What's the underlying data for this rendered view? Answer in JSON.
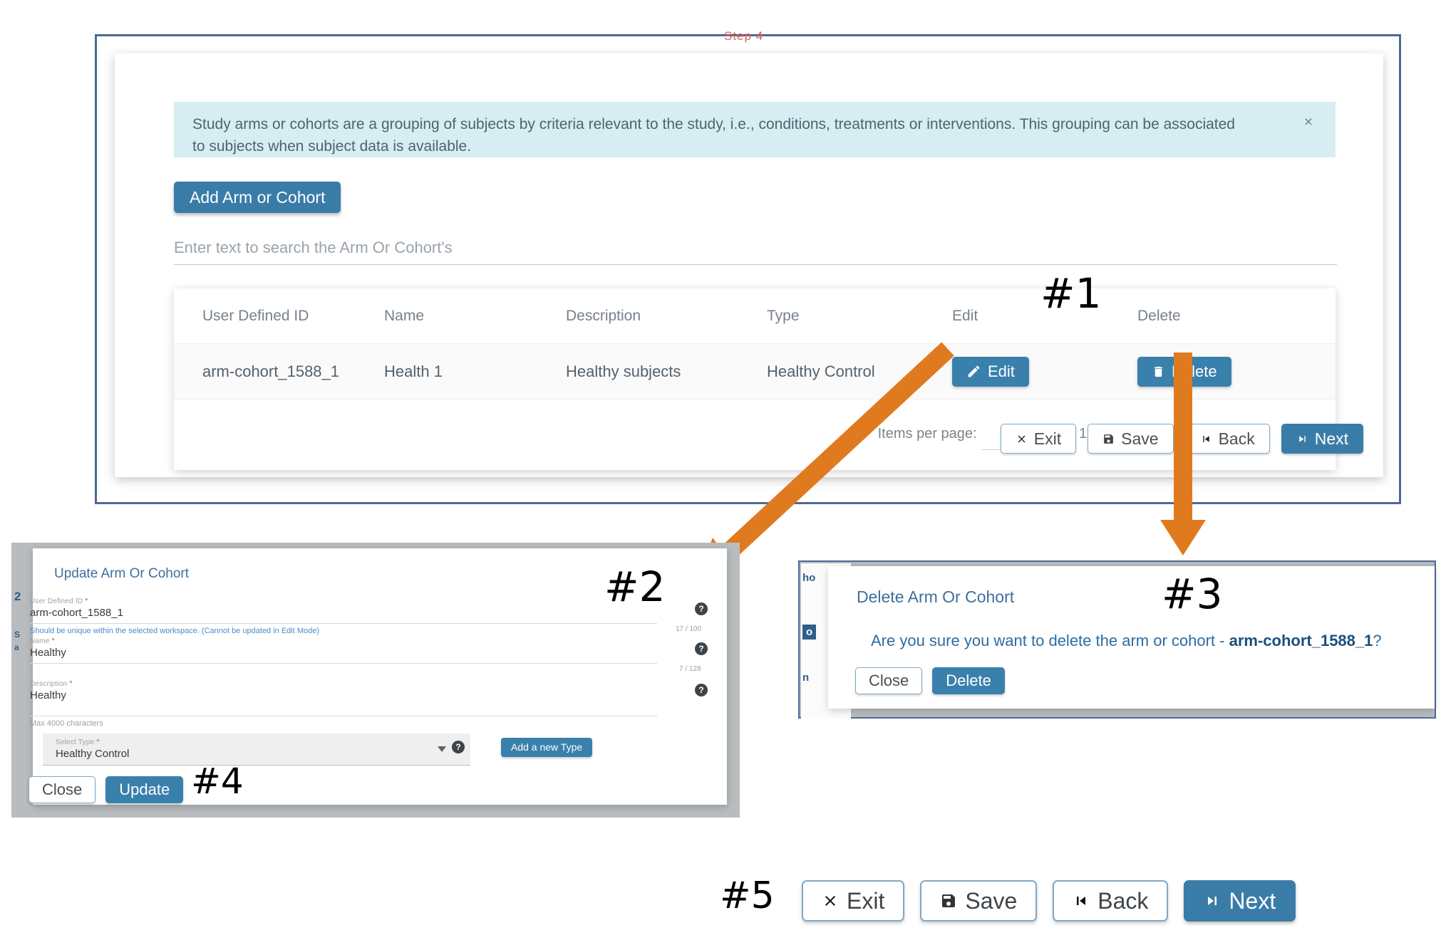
{
  "step_label": "Step 4",
  "info_banner": {
    "text": "Study arms or cohorts are a grouping of subjects by criteria relevant to the study, i.e., conditions, treatments or interventions. This grouping can be associated to subjects when subject data is available.",
    "close_icon": "close-icon",
    "close_glyph": "×",
    "background": "#d7edf1"
  },
  "add_button": {
    "label": "Add Arm or Cohort"
  },
  "search": {
    "placeholder": "Enter text to search the Arm Or Cohort's",
    "value": ""
  },
  "table": {
    "headers": [
      "User Defined ID",
      "Name",
      "Description",
      "Type",
      "Edit",
      "Delete"
    ],
    "rows": [
      {
        "user_defined_id": "arm-cohort_1588_1",
        "name": "Health 1",
        "description": "Healthy subjects",
        "type": "Healthy Control",
        "edit_label": "Edit",
        "delete_label": "Delete"
      }
    ]
  },
  "paginator": {
    "items_per_page_label": "Items per page:",
    "items_per_page_value": "",
    "range_label": "1 – 1 of 1",
    "first_page_glyph": "|‹",
    "prev_page_glyph": "‹",
    "next_page_glyph": "›",
    "last_page_glyph": "›|"
  },
  "panel_footer": {
    "exit": "Exit",
    "save": "Save",
    "back": "Back",
    "next": "Next"
  },
  "markers": {
    "one": "#1",
    "two": "#2",
    "three": "#3",
    "four": "#4",
    "five": "#5"
  },
  "update_dialog": {
    "title": "Update Arm Or Cohort",
    "fields": {
      "user_defined_id": {
        "label": "User Defined ID",
        "required_marker": "*",
        "value": "arm-cohort_1588_1",
        "hint": "Should be unique within the selected workspace. (Cannot be updated in Edit Mode)",
        "counter": "17 / 100"
      },
      "name": {
        "label": "Name",
        "required_marker": "*",
        "value": "Healthy",
        "counter": "7 / 128"
      },
      "description": {
        "label": "Description",
        "required_marker": "*",
        "value": "Healthy",
        "hint": "Max 4000 characters"
      },
      "select_type": {
        "label": "Select Type",
        "required_marker": "*",
        "value": "Healthy Control"
      }
    },
    "add_type_button": "Add a new Type",
    "close_button": "Close",
    "update_button": "Update",
    "bg_fragments": [
      "2",
      "S",
      "a"
    ]
  },
  "delete_dialog": {
    "title": "Delete Arm Or Cohort",
    "message_prefix": "Are you sure you want to delete the arm or cohort - ",
    "message_target": "arm-cohort_1588_1",
    "message_suffix": "?",
    "close_button": "Close",
    "delete_button": "Delete",
    "bg_fragments": [
      "ho",
      "o",
      "n"
    ]
  },
  "bottom_bar": {
    "exit": "Exit",
    "save": "Save",
    "back": "Back",
    "next": "Next"
  },
  "colors": {
    "primary": "#3a7ca8",
    "panel_border": "#4d6a96",
    "banner_bg": "#d7edf1",
    "arrow": "#e07a1f",
    "link_blue": "#2d6ca2",
    "required_red": "#e05151"
  }
}
